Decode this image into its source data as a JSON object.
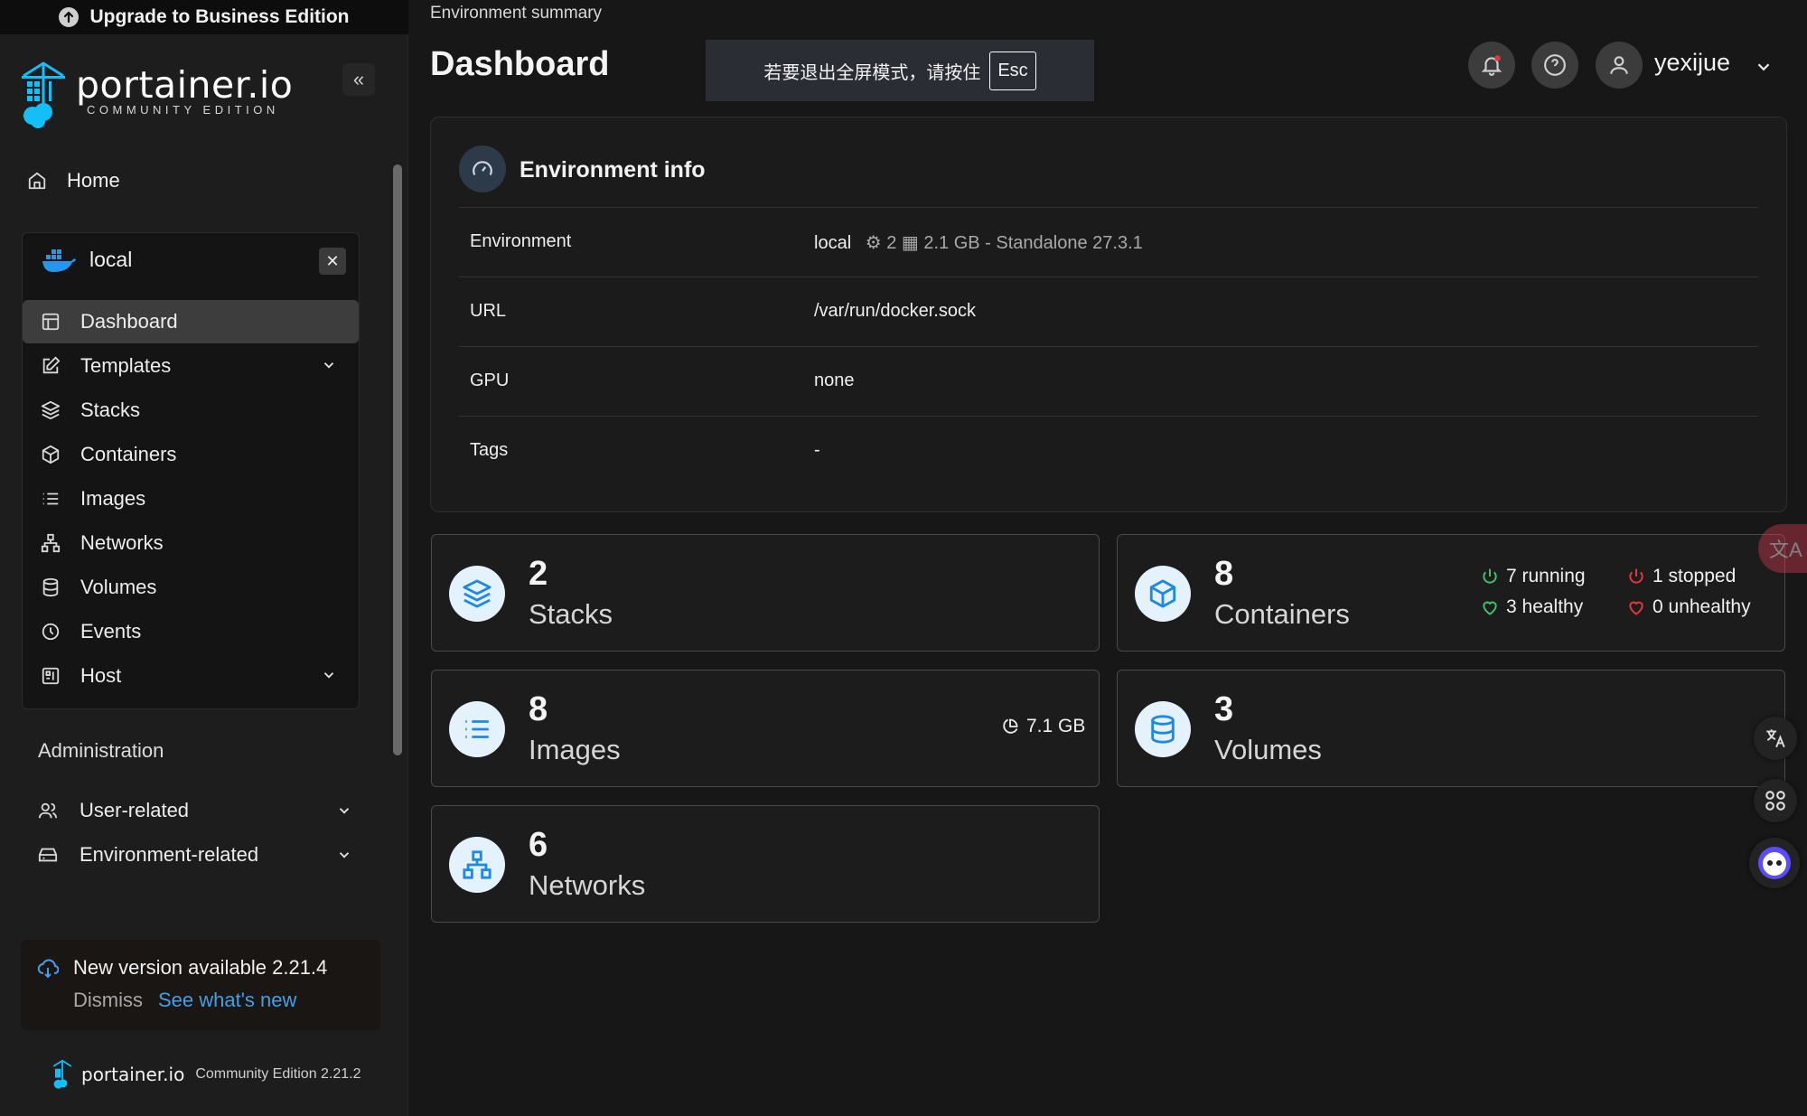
{
  "sidebar": {
    "upgrade_label": "Upgrade to Business Edition",
    "logo_name": "portainer.io",
    "logo_sub": "COMMUNITY EDITION",
    "home_label": "Home",
    "environment": {
      "name": "local",
      "items": [
        {
          "label": "Dashboard",
          "icon": "dashboard-icon",
          "active": true,
          "has_chevron": false
        },
        {
          "label": "Templates",
          "icon": "edit-icon",
          "active": false,
          "has_chevron": true
        },
        {
          "label": "Stacks",
          "icon": "layers-icon",
          "active": false,
          "has_chevron": false
        },
        {
          "label": "Containers",
          "icon": "box-icon",
          "active": false,
          "has_chevron": false
        },
        {
          "label": "Images",
          "icon": "list-icon",
          "active": false,
          "has_chevron": false
        },
        {
          "label": "Networks",
          "icon": "network-icon",
          "active": false,
          "has_chevron": false
        },
        {
          "label": "Volumes",
          "icon": "database-icon",
          "active": false,
          "has_chevron": false
        },
        {
          "label": "Events",
          "icon": "clock-icon",
          "active": false,
          "has_chevron": false
        },
        {
          "label": "Host",
          "icon": "host-icon",
          "active": false,
          "has_chevron": true
        }
      ]
    },
    "admin_title": "Administration",
    "admin_items": [
      {
        "label": "User-related",
        "icon": "users-icon"
      },
      {
        "label": "Environment-related",
        "icon": "drive-icon"
      }
    ],
    "update": {
      "title": "New version available 2.21.4",
      "dismiss": "Dismiss",
      "whats_new": "See what's new"
    },
    "footer": {
      "name": "portainer.io",
      "edition": "Community Edition 2.21.2"
    }
  },
  "header": {
    "breadcrumb": "Environment summary",
    "title": "Dashboard",
    "fullscreen_notice": "若要退出全屏模式，请按住",
    "esc_key": "Esc",
    "username": "yexijue"
  },
  "env_info": {
    "title": "Environment info",
    "rows": [
      {
        "key": "Environment",
        "value": "local",
        "extra": "2",
        "extra2": "2.1 GB - Standalone 27.3.1"
      },
      {
        "key": "URL",
        "value": "/var/run/docker.sock"
      },
      {
        "key": "GPU",
        "value": "none"
      },
      {
        "key": "Tags",
        "value": "-"
      }
    ]
  },
  "stats": {
    "stacks": {
      "count": "2",
      "label": "Stacks"
    },
    "containers": {
      "count": "8",
      "label": "Containers",
      "running": "7 running",
      "stopped": "1 stopped",
      "healthy": "3 healthy",
      "unhealthy": "0 unhealthy"
    },
    "images": {
      "count": "8",
      "label": "Images",
      "size": "7.1 GB"
    },
    "volumes": {
      "count": "3",
      "label": "Volumes"
    },
    "networks": {
      "count": "6",
      "label": "Networks"
    }
  },
  "colors": {
    "accent_blue": "#3ea1ea",
    "green": "#3fbf6b",
    "red": "#e0383e",
    "icon_bg": "#e3f2fd"
  }
}
